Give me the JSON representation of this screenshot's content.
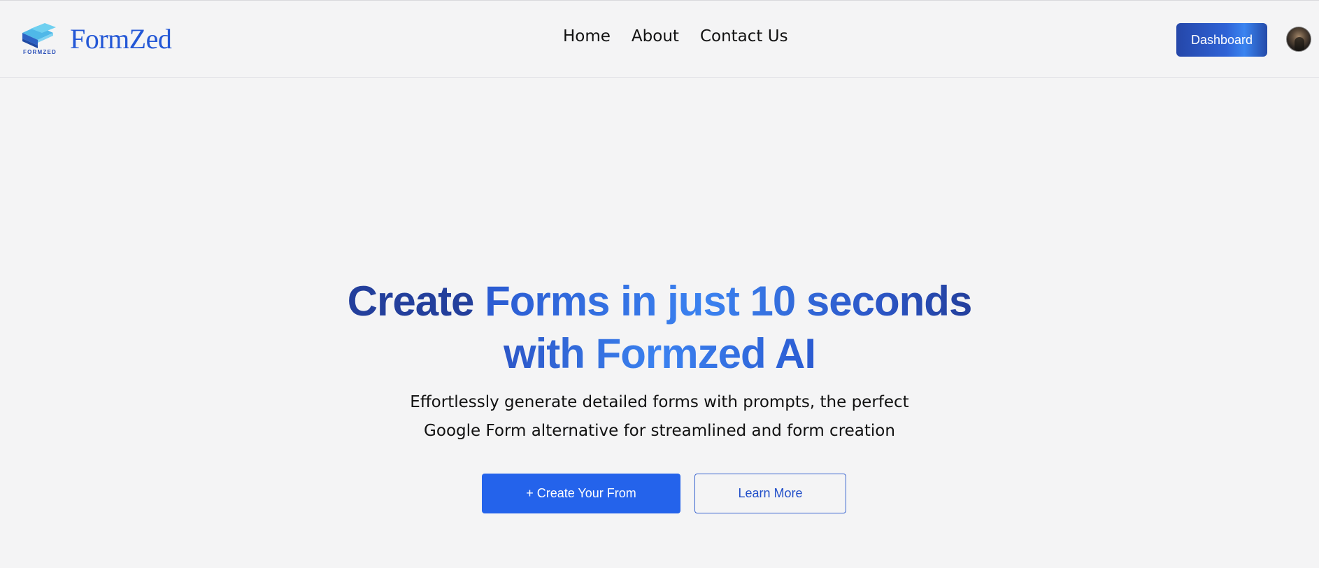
{
  "navbar": {
    "brand_name": "FormZed",
    "logo_caption": "FORMZED",
    "links": [
      {
        "label": "Home"
      },
      {
        "label": "About"
      },
      {
        "label": "Contact Us"
      }
    ],
    "dashboard_label": "Dashboard"
  },
  "hero": {
    "title_part1": "Create",
    "title_part2": "Forms in just 10 seconds",
    "title_part3": "with Formzed AI",
    "subtitle_line1": "Effortlessly generate detailed forms with prompts, the perfect",
    "subtitle_line2": "Google Form alternative for streamlined and form creation",
    "primary_cta": "+ Create Your From",
    "secondary_cta": "Learn More"
  },
  "colors": {
    "background": "#f4f4f5",
    "brand_blue": "#2357d6",
    "primary_button": "#2463eb",
    "title_dark": "#233f9c"
  }
}
